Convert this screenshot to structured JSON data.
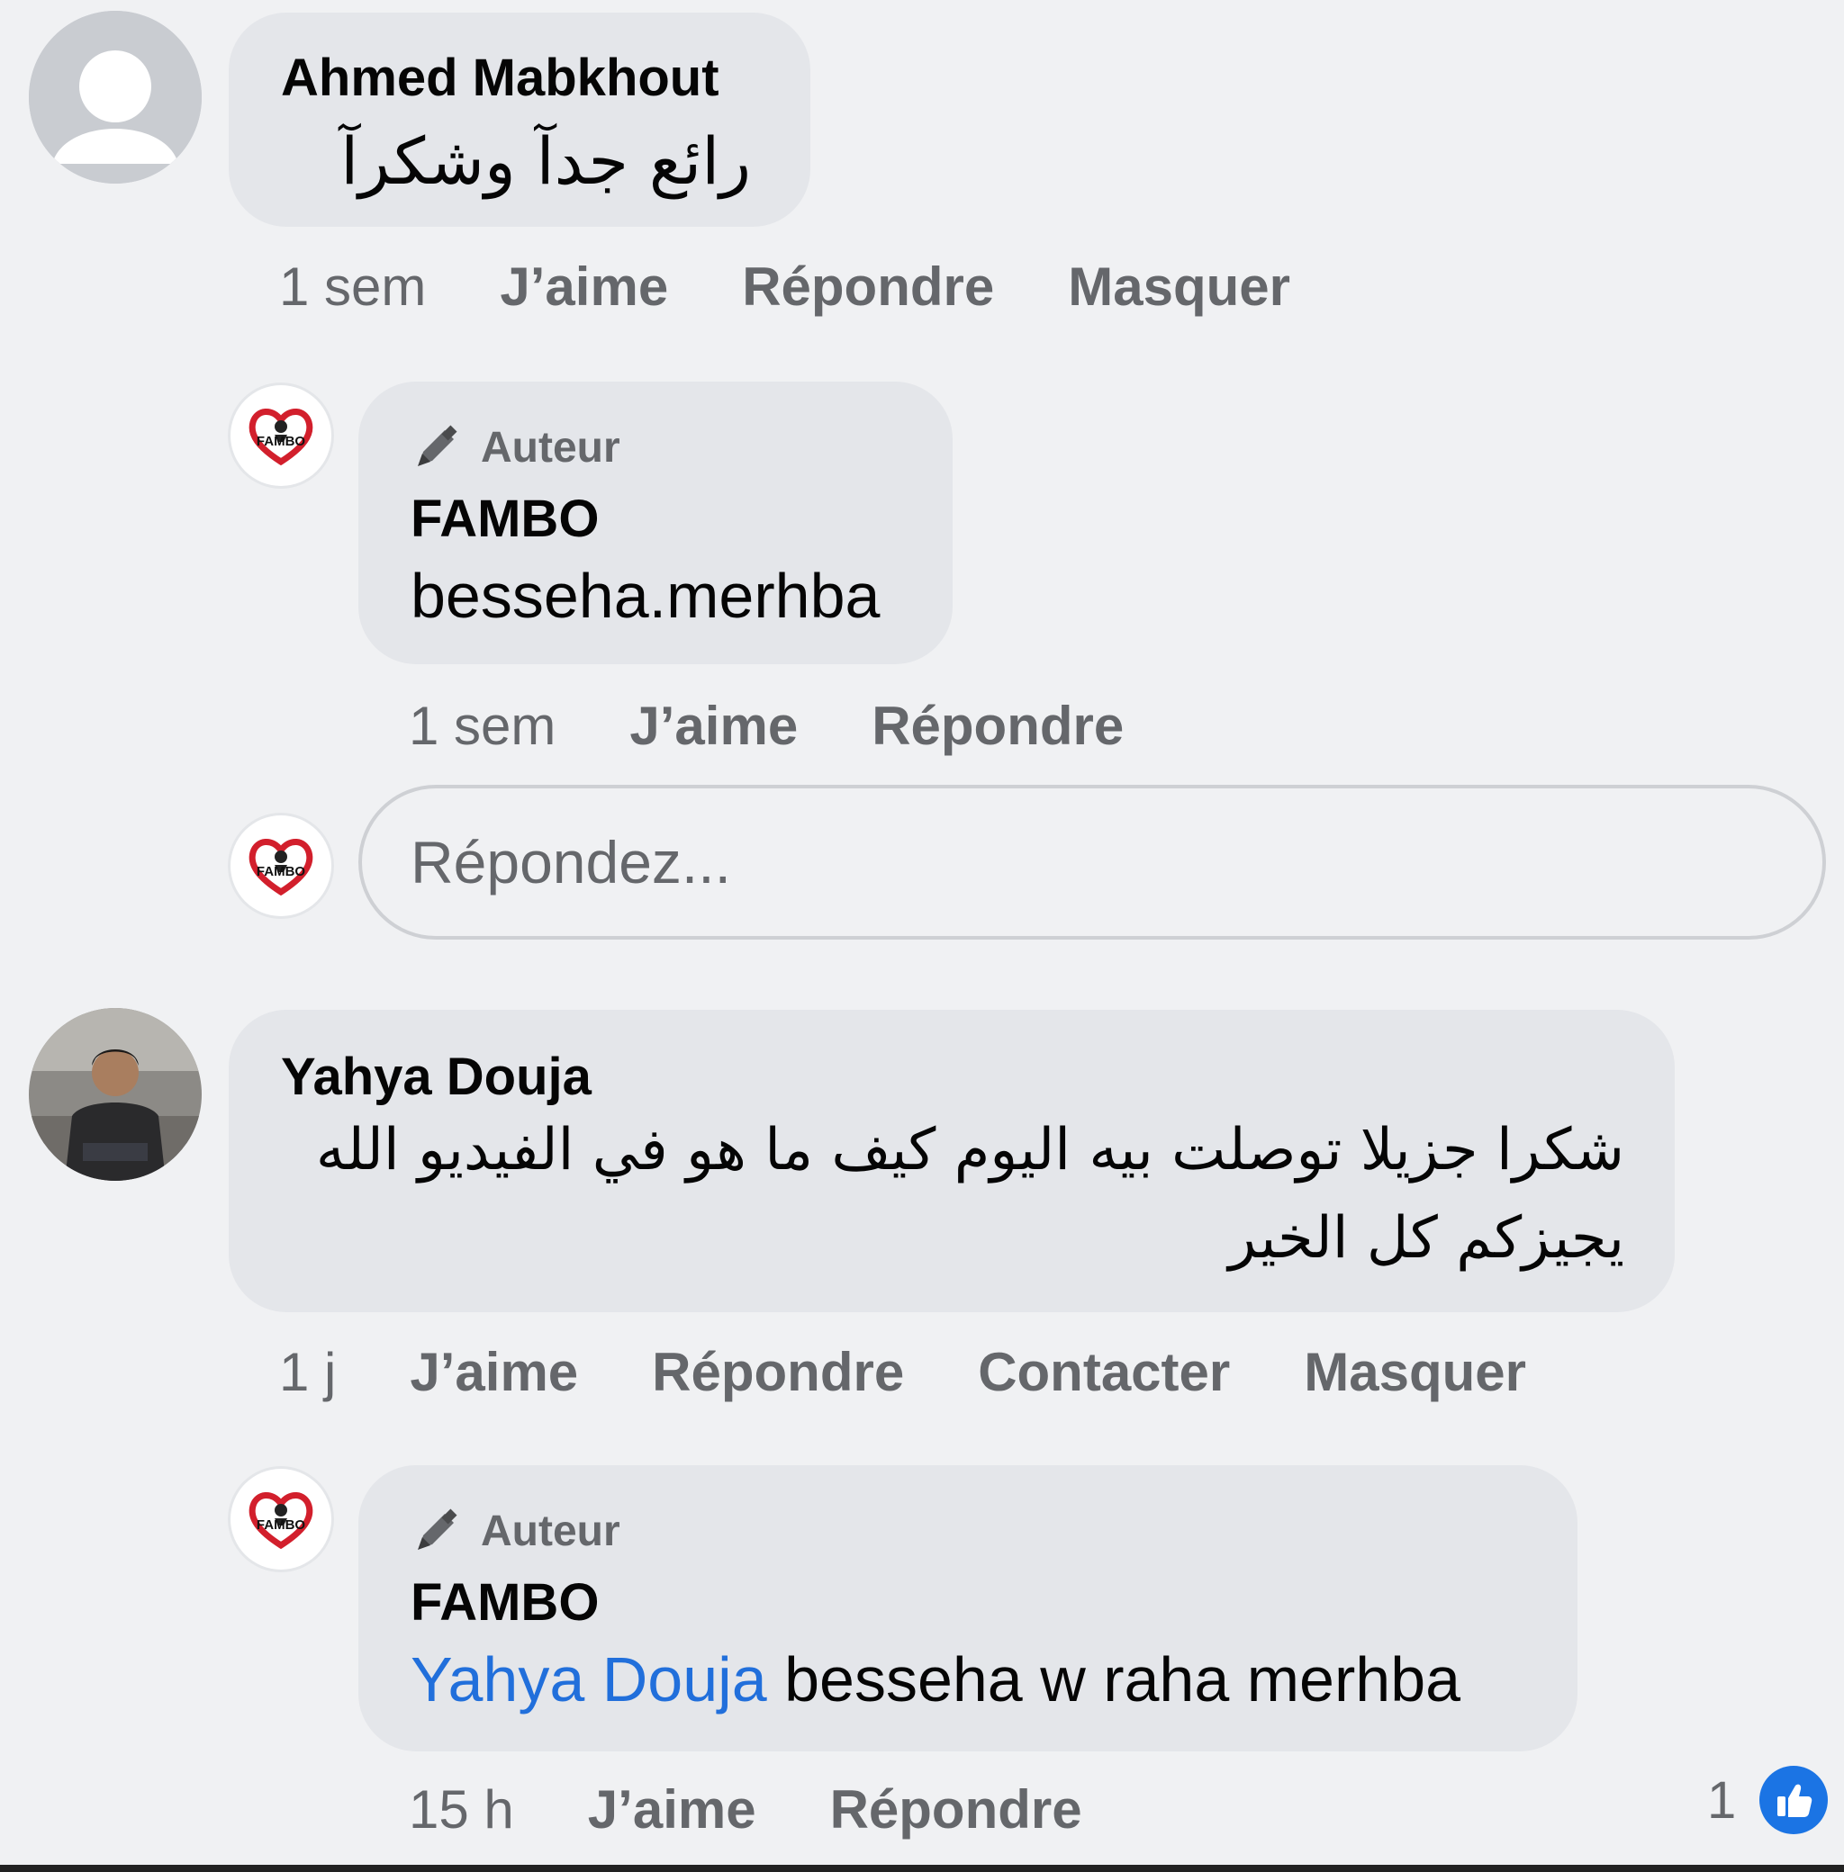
{
  "comments": [
    {
      "author": "Ahmed Mabkhout",
      "text": "رائع  جدآ  وشكرآ",
      "time": "1 sem",
      "actions": [
        "J’aime",
        "Répondre",
        "Masquer"
      ]
    },
    {
      "author": "Yahya Douja",
      "text_line1": "شكرا جزيلا توصلت بيه اليوم كيف ما هو في الفيديو الله",
      "text_line2": "يجيزكم كل الخير",
      "time": "1 j",
      "actions": [
        "J’aime",
        "Répondre",
        "Contacter",
        "Masquer"
      ]
    }
  ],
  "replies": [
    {
      "badge": "Auteur",
      "author": "FAMBO",
      "text": "besseha.merhba",
      "time": "1 sem",
      "actions": [
        "J’aime",
        "Répondre"
      ]
    },
    {
      "badge": "Auteur",
      "author": "FAMBO",
      "mention": "Yahya Douja",
      "text": " besseha w raha merhba",
      "time": "15 h",
      "actions": [
        "J’aime",
        "Répondre"
      ],
      "reaction_count": "1"
    }
  ],
  "reply_box": {
    "placeholder": "Répondez..."
  },
  "logo_text": "FAMBO",
  "icons": {
    "author_badge": "pencil-icon",
    "reaction": "thumbs-up-icon",
    "default_avatar": "default-user-avatar"
  },
  "colors": {
    "bubble": "#e4e6ea",
    "mention": "#216fdb",
    "like": "#1b74e4",
    "meta": "#65676b"
  }
}
